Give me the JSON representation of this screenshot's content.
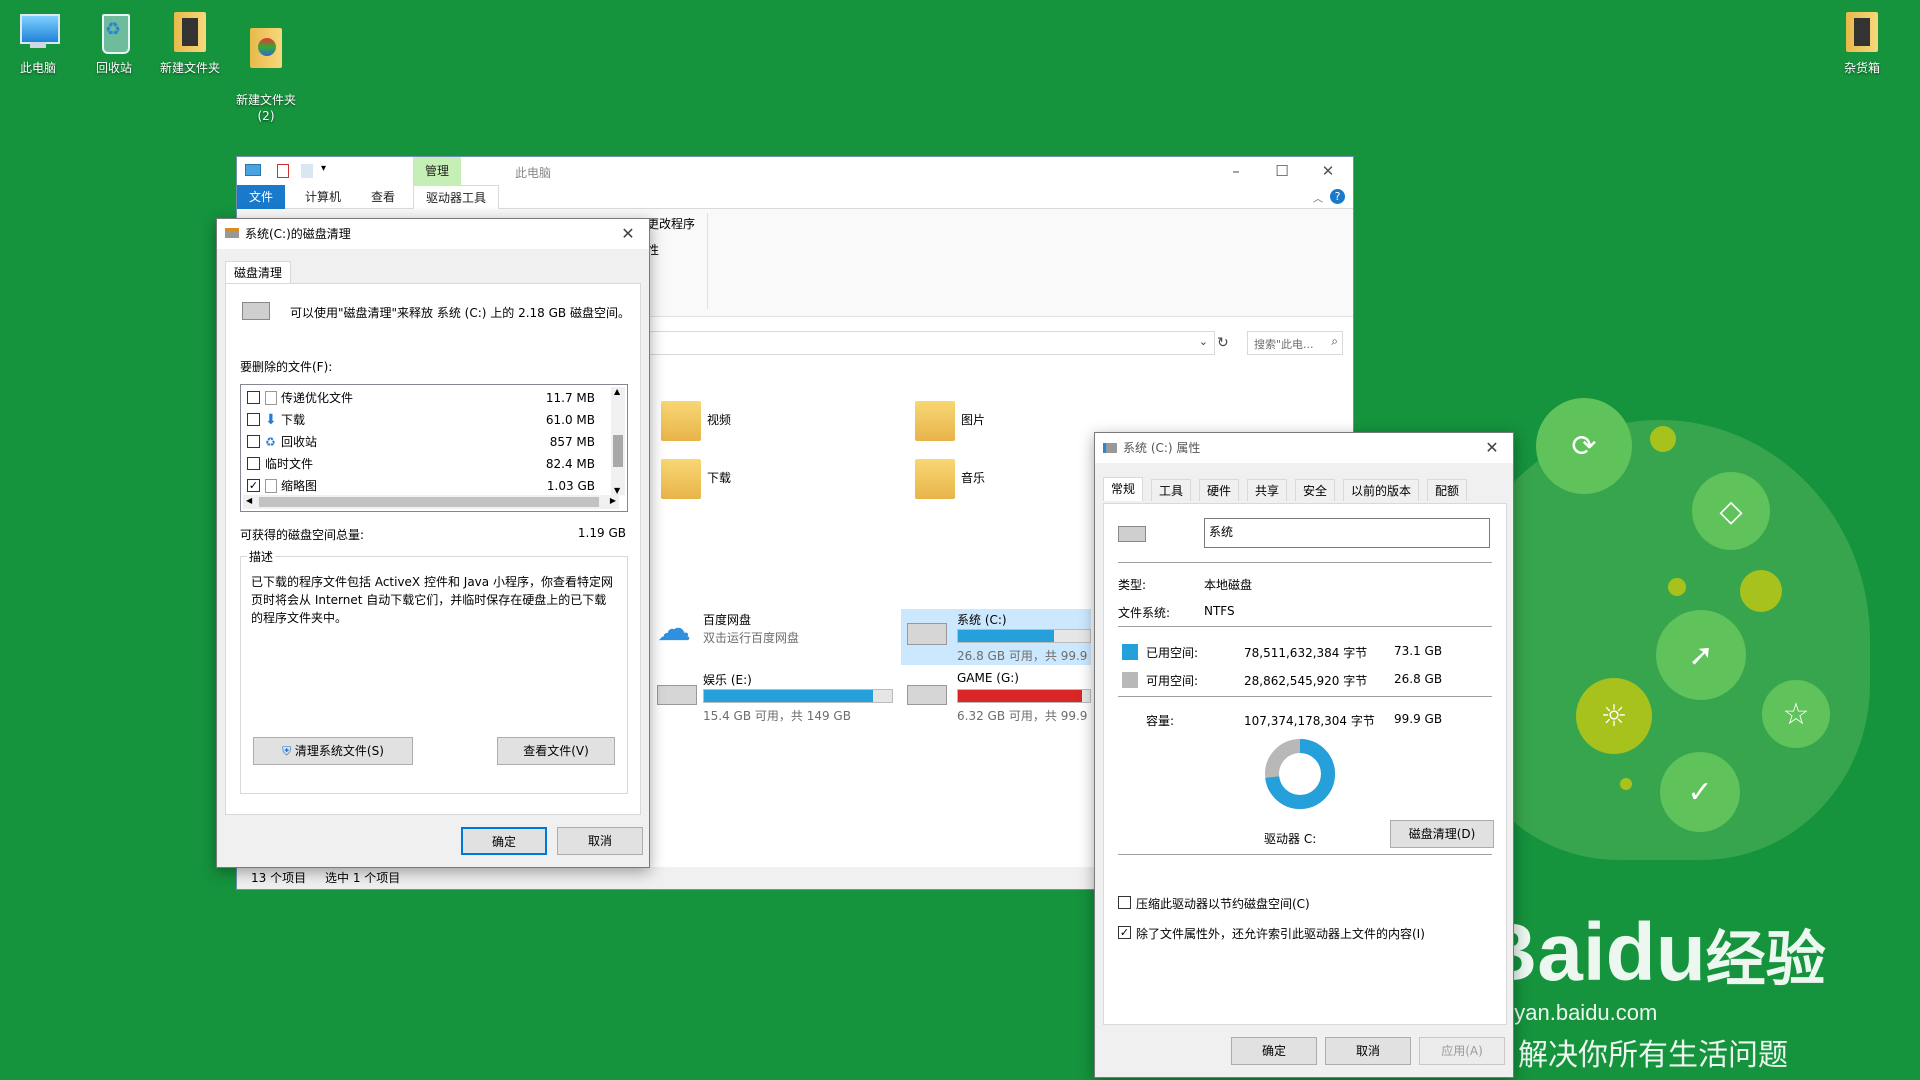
{
  "desktop": {
    "icons": [
      {
        "label": "此电脑",
        "icon": "computer-icon"
      },
      {
        "label": "回收站",
        "icon": "recycle-bin-icon"
      },
      {
        "label": "新建文件夹",
        "icon": "folder-icon"
      },
      {
        "label": "新建文件夹\n(2)",
        "icon": "folder-icon"
      },
      {
        "label": "杂货箱",
        "icon": "folder-icon"
      }
    ]
  },
  "explorer": {
    "title": "此电脑",
    "manage_tab": "管理",
    "tabs": [
      "文件",
      "计算机",
      "查看",
      "驱动器工具"
    ],
    "ribbon_partial": [
      "更改程序",
      "性"
    ],
    "search_placeholder": "搜索\"此电...",
    "folders": [
      {
        "name": "视频",
        "icon": "video-folder-icon"
      },
      {
        "name": "图片",
        "icon": "pictures-folder-icon"
      },
      {
        "name": "下载",
        "icon": "downloads-folder-icon"
      },
      {
        "name": "音乐",
        "icon": "music-folder-icon"
      }
    ],
    "locations": [
      {
        "name": "百度网盘",
        "sub": "双击运行百度网盘"
      },
      {
        "name": "系统 (C:)",
        "sub": "26.8 GB 可用，共 99.9 G",
        "fill": 0.73
      },
      {
        "name": "娱乐 (E:)",
        "sub": "15.4 GB 可用，共 149 GB",
        "fill": 0.9
      },
      {
        "name": "GAME (G:)",
        "sub": "6.32 GB 可用，共 99.9 G",
        "fill": 0.94
      }
    ],
    "status": {
      "count": "13 个项目",
      "selected": "选中 1 个项目"
    }
  },
  "cleanup": {
    "title": "系统(C:)的磁盘清理",
    "tab": "磁盘清理",
    "intro": "可以使用\"磁盘清理\"来释放 系统 (C:) 上的 2.18 GB 磁盘空间。",
    "files_label": "要删除的文件(F):",
    "files": [
      {
        "name": "传递优化文件",
        "size": "11.7 MB",
        "checked": false
      },
      {
        "name": "下载",
        "size": "61.0 MB",
        "checked": false
      },
      {
        "name": "回收站",
        "size": "857 MB",
        "checked": false
      },
      {
        "name": "临时文件",
        "size": "82.4 MB",
        "checked": false
      },
      {
        "name": "缩略图",
        "size": "1.03 GB",
        "checked": true
      }
    ],
    "total_label": "可获得的磁盘空间总量:",
    "total_value": "1.19 GB",
    "desc_label": "描述",
    "desc_text": "已下载的程序文件包括 ActiveX 控件和 Java 小程序，你查看特定网页时将会从 Internet 自动下载它们，并临时保存在硬盘上的已下载的程序文件夹中。",
    "btn_clean_sys": "清理系统文件(S)",
    "btn_view": "查看文件(V)",
    "btn_ok": "确定",
    "btn_cancel": "取消"
  },
  "props": {
    "title": "系统 (C:) 属性",
    "tabs": [
      "常规",
      "工具",
      "硬件",
      "共享",
      "安全",
      "以前的版本",
      "配额"
    ],
    "name_value": "系统",
    "type_label": "类型:",
    "type_value": "本地磁盘",
    "fs_label": "文件系统:",
    "fs_value": "NTFS",
    "used_label": "已用空间:",
    "used_bytes": "78,511,632,384 字节",
    "used_gb": "73.1 GB",
    "free_label": "可用空间:",
    "free_bytes": "28,862,545,920 字节",
    "free_gb": "26.8 GB",
    "cap_label": "容量:",
    "cap_bytes": "107,374,178,304 字节",
    "cap_gb": "99.9 GB",
    "used_fraction": 0.731,
    "drive_label": "驱动器 C:",
    "btn_cleanup": "磁盘清理(D)",
    "compress": "压缩此驱动器以节约磁盘空间(C)",
    "index": "除了文件属性外，还允许索引此驱动器上文件的内容(I)",
    "btn_ok": "确定",
    "btn_cancel": "取消",
    "btn_apply": "应用(A)",
    "colors": {
      "used": "#26a0da",
      "free": "#b8b8b8"
    }
  },
  "watermark": {
    "line1": "Bai",
    "logo_mid": "du",
    "line2": "经验",
    "url": "jingyan.baidu.com",
    "slogan": "解决你所有生活问题"
  }
}
